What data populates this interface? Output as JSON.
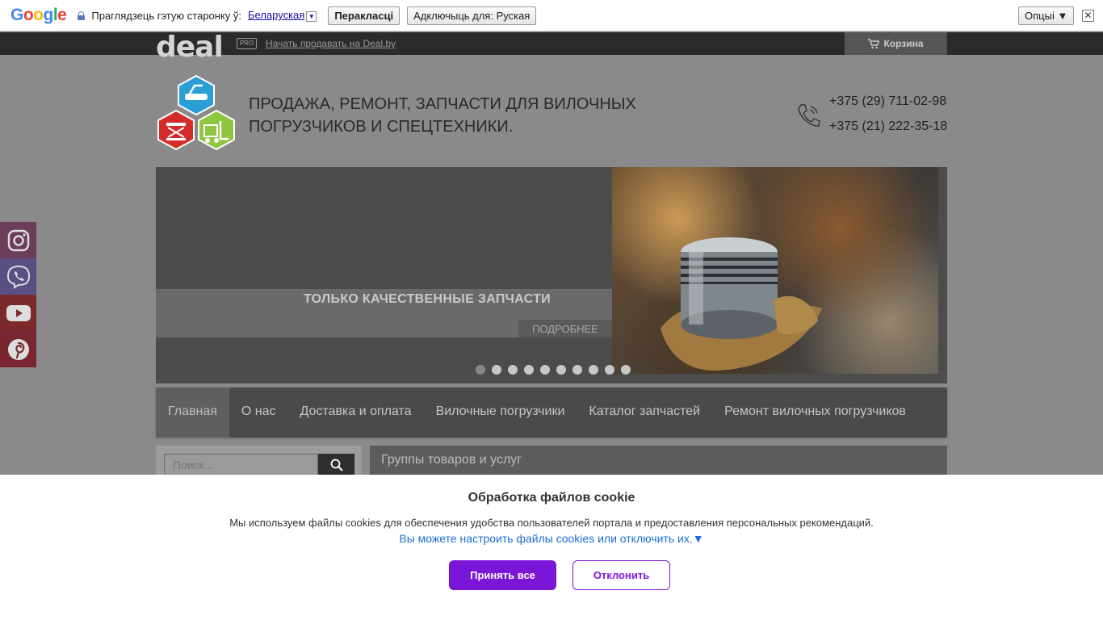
{
  "translate_bar": {
    "logo": "Google",
    "prompt": "Праглядзець гэтую старонку ў:",
    "language": "Беларуская",
    "translate_button": "Перакласці",
    "disable_button": "Адключыць для: Руская",
    "options_button": "Опцыі ▼",
    "close_glyph": "✕"
  },
  "deal_bar": {
    "logo": "deal",
    "pro_badge": "PRO",
    "sell_link": "Начать продавать на Deal.by",
    "cart_label": "Корзина"
  },
  "header": {
    "tagline_line1": "ПРОДАЖА, РЕМОНТ, ЗАПЧАСТИ ДЛЯ ВИЛОЧНЫХ",
    "tagline_line2": "ПОГРУЗЧИКОВ И СПЕЦТЕХНИКИ.",
    "phone1": "+375 (29) 711-02-98",
    "phone2": "+375 (21) 222-35-18"
  },
  "slider": {
    "title": "ТОЛЬКО КАЧЕСТВЕННЫЕ ЗАПЧАСТИ",
    "more_button": "ПОДРОБНЕЕ",
    "dot_count": 10,
    "active_dot": 1
  },
  "nav": {
    "items": [
      {
        "label": "Главная",
        "active": true
      },
      {
        "label": "О нас"
      },
      {
        "label": "Доставка и оплата"
      },
      {
        "label": "Вилочные погрузчики"
      },
      {
        "label": "Каталог запчастей"
      },
      {
        "label": "Ремонт вилочных погрузчиков"
      }
    ]
  },
  "search": {
    "placeholder": "Поиск..."
  },
  "groups": {
    "title": "Группы товаров и услуг"
  },
  "social": [
    {
      "icon": "instagram-icon",
      "color": "#c13584"
    },
    {
      "icon": "viber-icon",
      "color": "#7360f2"
    },
    {
      "icon": "youtube-icon",
      "color": "#ff0000"
    },
    {
      "icon": "pinterest-icon",
      "color": "#e60023"
    }
  ],
  "cookie": {
    "title": "Обработка файлов cookie",
    "text": "Мы используем файлы cookies для обеспечения удобства пользователей портала и предоставления персональных рекомендаций.",
    "link": "Вы можете настроить файлы cookies или отключить их.▼",
    "accept": "Принять все",
    "reject": "Отклонить",
    "accent_color": "#7b16d9"
  }
}
